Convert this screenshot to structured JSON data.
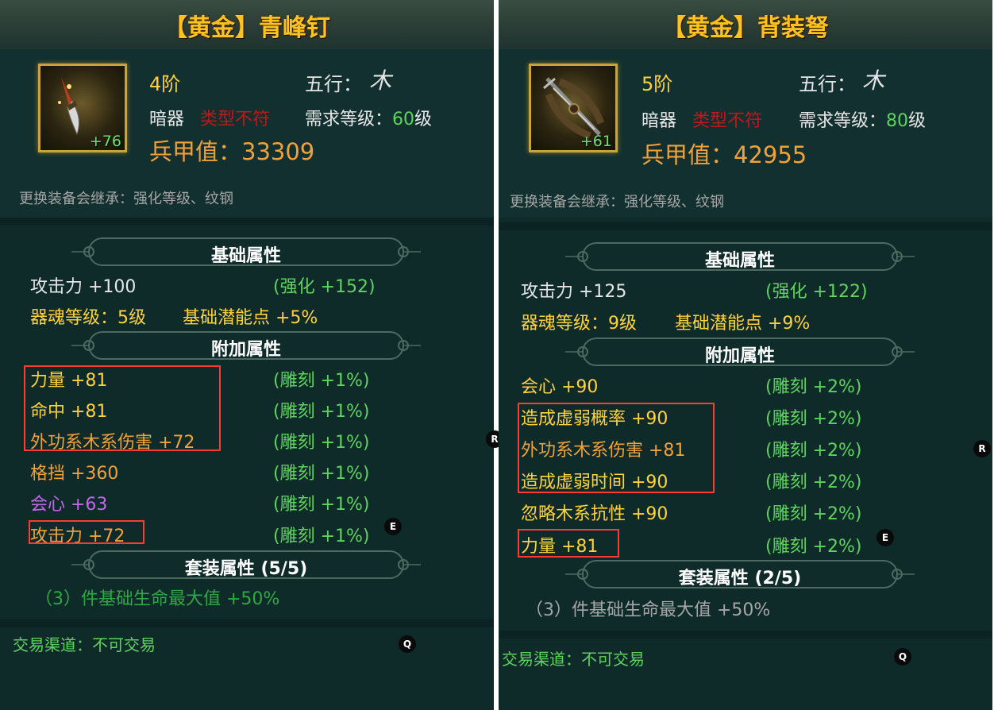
{
  "left": {
    "title": "【黄金】青峰钉",
    "icon_plus": "+76",
    "tier": "4阶",
    "element_label": "五行：",
    "element_glyph": "木",
    "type": "暗器",
    "type_status": "类型不符",
    "req_level_label": "需求等级：",
    "req_level_value": "60",
    "req_level_unit": "级",
    "armor_value": "兵甲值：33309",
    "inherit_text": "更换装备会继承：强化等级、纹钢",
    "base_header": "基础属性",
    "attack_line": "攻击力  +100",
    "attack_bonus": "(强化 +152)",
    "soul_line": "器魂等级：5级",
    "potential_line": "基础潜能点  +5%",
    "extra_header": "附加属性",
    "extra_attrs": [
      {
        "name": "力量  +81",
        "bonus": "(雕刻 +1%)"
      },
      {
        "name": "命中  +81",
        "bonus": "(雕刻 +1%)"
      },
      {
        "name": "外功系木系伤害  +72",
        "bonus": "(雕刻 +1%)"
      },
      {
        "name": "格挡  +360",
        "bonus": "(雕刻 +1%)"
      },
      {
        "name": "会心  +63",
        "bonus": "(雕刻 +1%)"
      },
      {
        "name": "攻击力  +72",
        "bonus": "(雕刻 +1%)"
      }
    ],
    "set_header": "套装属性 (5/5)",
    "set_bonus": "（3）件基础生命最大值  +50%",
    "trade": "交易渠道：不可交易",
    "badges": [
      "R",
      "E",
      "Q"
    ]
  },
  "right": {
    "title": "【黄金】背装弩",
    "icon_plus": "+61",
    "tier": "5阶",
    "element_label": "五行：",
    "element_glyph": "木",
    "type": "暗器",
    "type_status": "类型不符",
    "req_level_label": "需求等级：",
    "req_level_value": "80",
    "req_level_unit": "级",
    "armor_value": "兵甲值：42955",
    "inherit_text": "更换装备会继承：强化等级、纹钢",
    "base_header": "基础属性",
    "attack_line": "攻击力  +125",
    "attack_bonus": "(强化 +122)",
    "soul_line": "器魂等级：9级",
    "potential_line": "基础潜能点  +9%",
    "extra_header": "附加属性",
    "extra_attrs": [
      {
        "name": "会心  +90",
        "bonus": "(雕刻 +2%)"
      },
      {
        "name": "造成虚弱概率  +90",
        "bonus": "(雕刻 +2%)"
      },
      {
        "name": "外功系木系伤害  +81",
        "bonus": "(雕刻 +2%)"
      },
      {
        "name": "造成虚弱时间  +90",
        "bonus": "(雕刻 +2%)"
      },
      {
        "name": "忽略木系抗性  +90",
        "bonus": "(雕刻 +2%)"
      },
      {
        "name": "力量  +81",
        "bonus": "(雕刻 +2%)"
      }
    ],
    "set_header": "套装属性 (2/5)",
    "set_bonus": "（3）件基础生命最大值  +50%",
    "trade": "交易渠道：不可交易",
    "badges": [
      "R",
      "E",
      "Q"
    ]
  },
  "colors": {
    "panel_bg": "#0e2b2a",
    "title_gold": "#ffc21f",
    "stat_yellow": "#ffd23b",
    "stat_orange": "#f0a23a",
    "stat_purple": "#c469e6",
    "bonus_green": "#5fd35f",
    "warning_red": "#c0181a",
    "highlight_red": "#ff3b30"
  }
}
